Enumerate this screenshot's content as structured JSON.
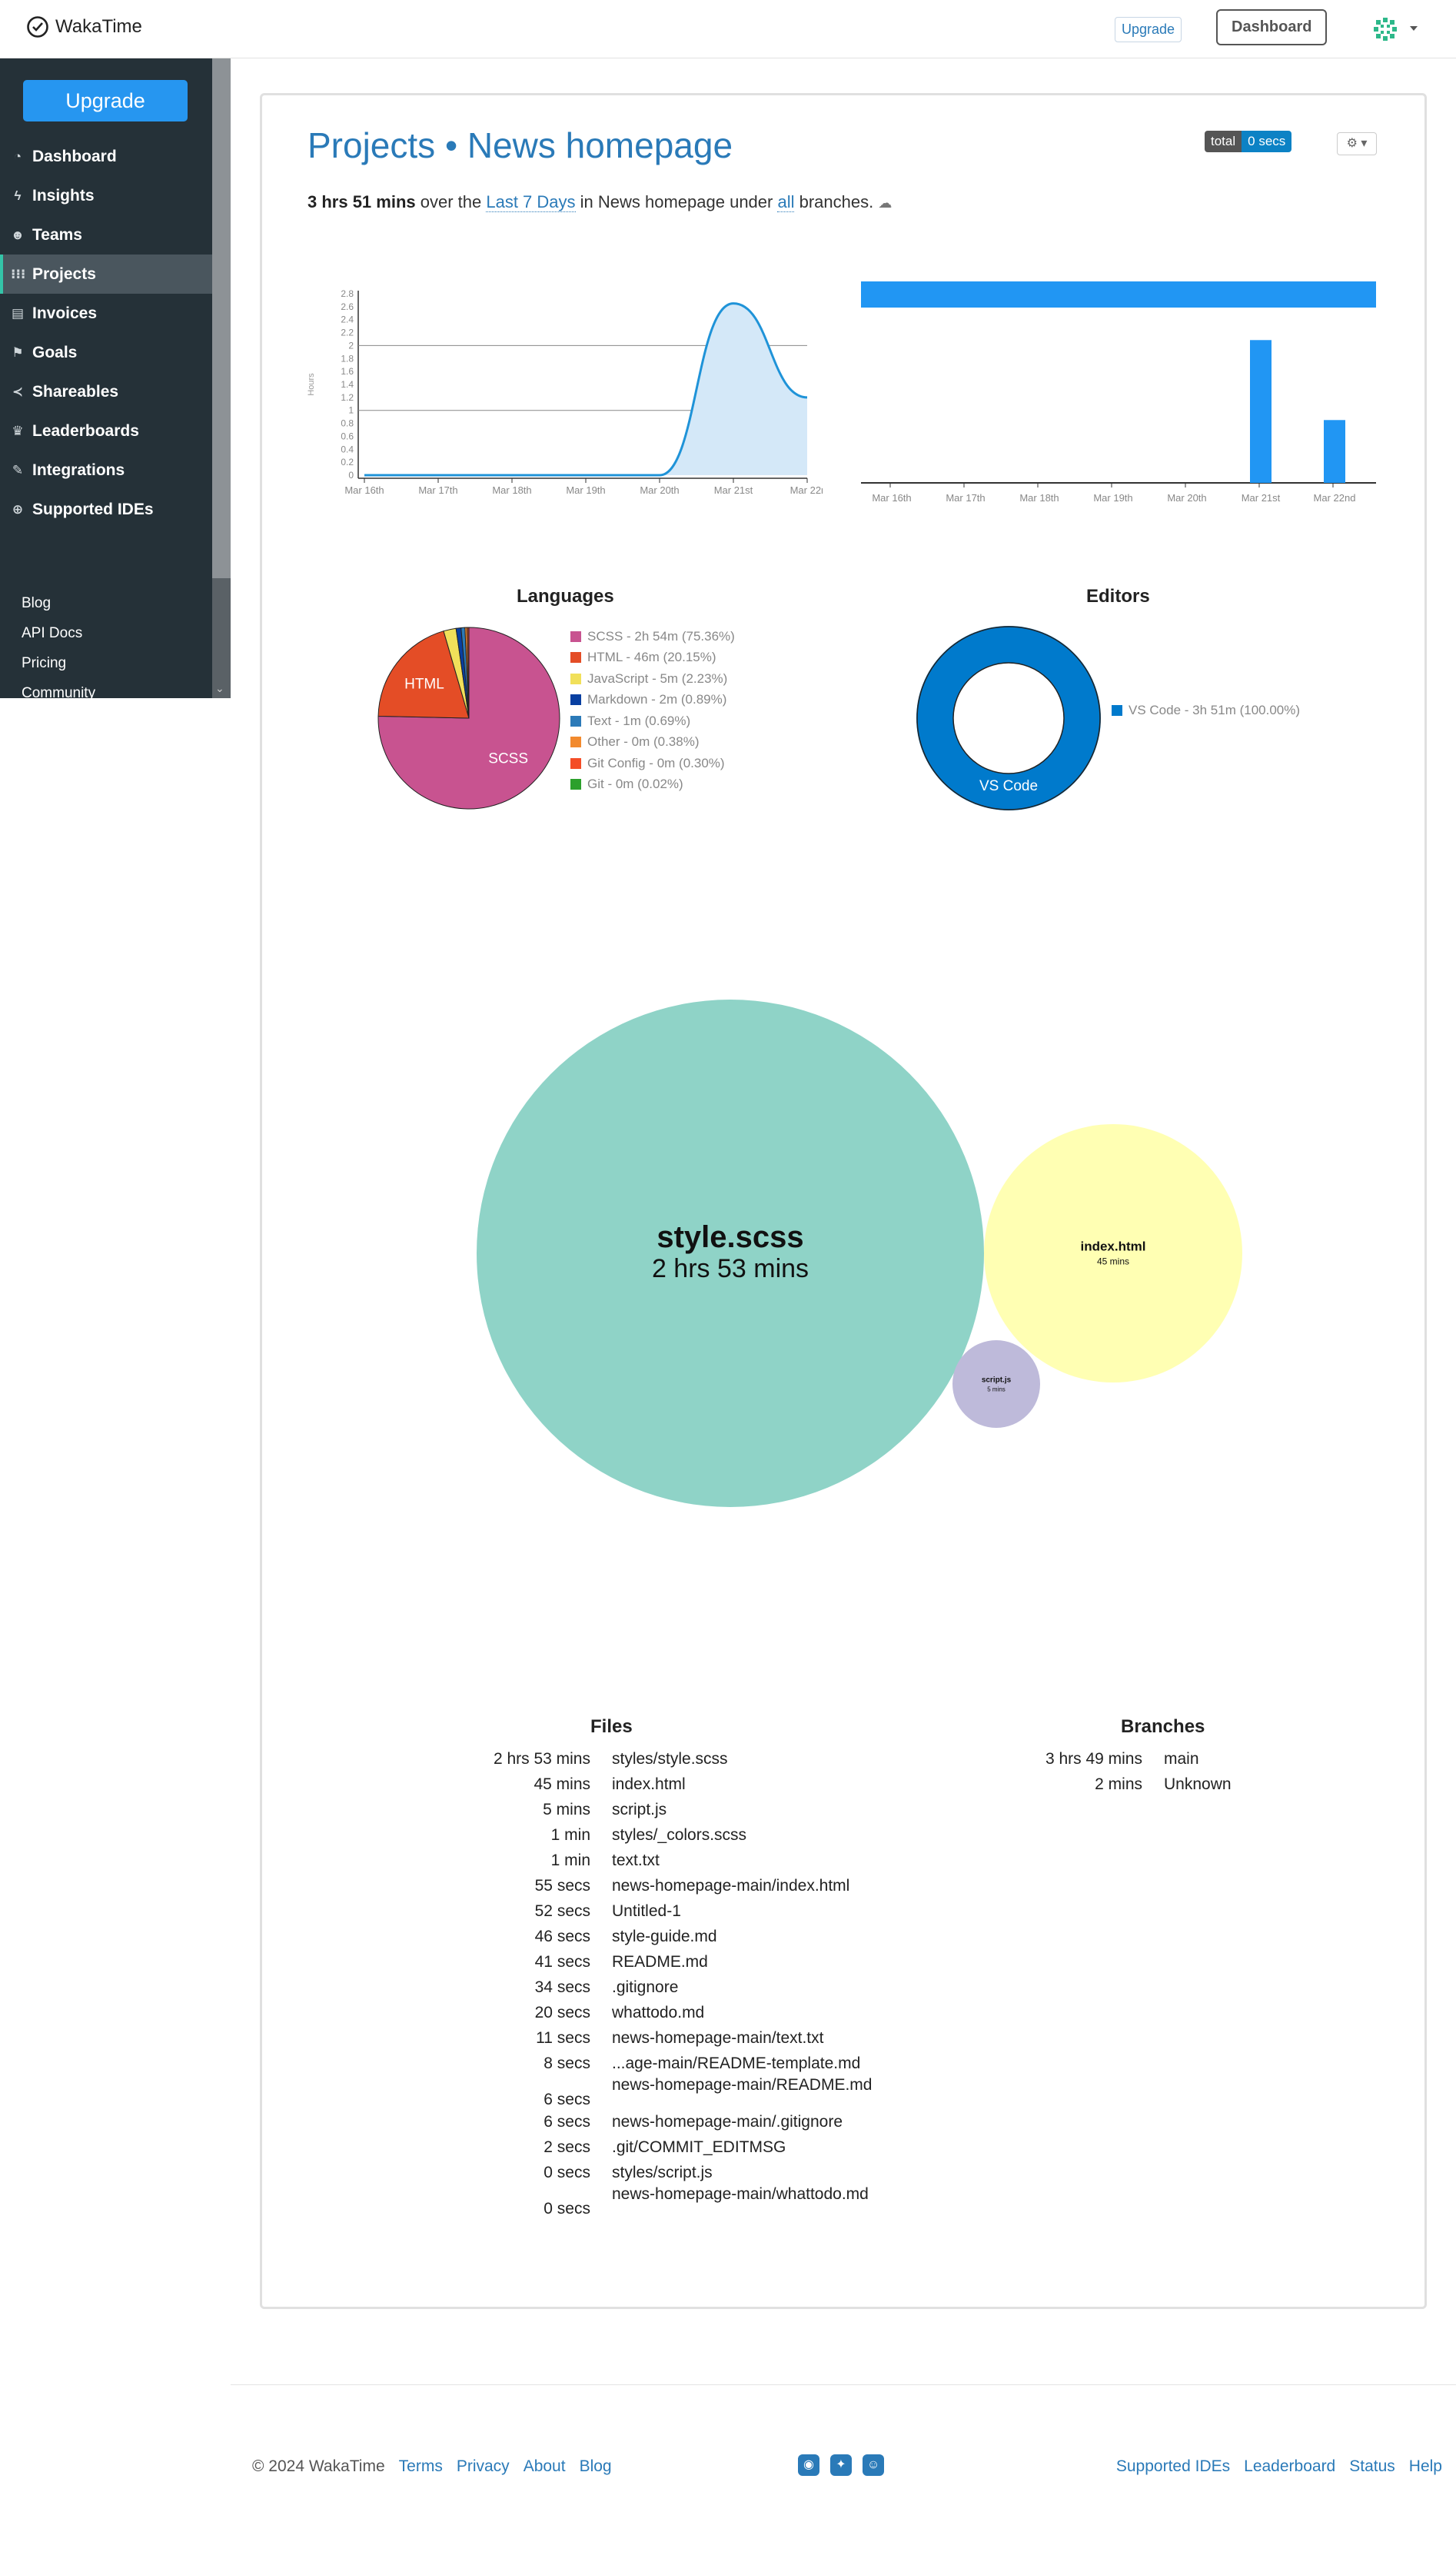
{
  "topbar": {
    "logo_text": "WakaTime",
    "upgrade_label": "Upgrade",
    "dashboard_label": "Dashboard"
  },
  "sidebar": {
    "upgrade_label": "Upgrade",
    "items": [
      {
        "label": "Dashboard",
        "icon": "tachometer-icon"
      },
      {
        "label": "Insights",
        "icon": "bolt-icon"
      },
      {
        "label": "Teams",
        "icon": "users-icon"
      },
      {
        "label": "Projects",
        "icon": "grid-icon",
        "active": true
      },
      {
        "label": "Invoices",
        "icon": "file-icon"
      },
      {
        "label": "Goals",
        "icon": "flag-icon"
      },
      {
        "label": "Shareables",
        "icon": "share-icon"
      },
      {
        "label": "Leaderboards",
        "icon": "trophy-icon"
      },
      {
        "label": "Integrations",
        "icon": "wrench-icon"
      },
      {
        "label": "Supported IDEs",
        "icon": "plus-circle-icon"
      }
    ],
    "links": [
      "Blog",
      "API Docs",
      "Pricing",
      "Community"
    ]
  },
  "header": {
    "title": "Projects • News homepage",
    "summary_bold": "3 hrs 51 mins",
    "summary_1": " over the ",
    "range_link": "Last 7 Days",
    "summary_2": " in News homepage under ",
    "branches_link": "all",
    "summary_3": " branches.",
    "badge_left": "total",
    "badge_right": "0 secs"
  },
  "chart_data": [
    {
      "type": "area",
      "ylabel": "Hours",
      "x": [
        "Mar 16th",
        "Mar 17th",
        "Mar 18th",
        "Mar 19th",
        "Mar 20th",
        "Mar 21st",
        "Mar 22r"
      ],
      "yticks": [
        "0",
        "0.2",
        "0.4",
        "0.6",
        "0.8",
        "1",
        "1.2",
        "1.4",
        "1.6",
        "1.8",
        "2",
        "2.2",
        "2.4",
        "2.6",
        "2.8"
      ],
      "values": [
        0.0,
        0.0,
        0.0,
        0.0,
        0.0,
        2.65,
        1.2
      ],
      "ylim": [
        0,
        2.8
      ]
    },
    {
      "type": "bar",
      "x": [
        "Mar 16th",
        "Mar 17th",
        "Mar 18th",
        "Mar 19th",
        "Mar 20th",
        "Mar 21st",
        "Mar 22nd"
      ],
      "values": [
        0,
        0,
        0,
        0,
        0,
        2.5,
        1.1
      ],
      "top_bar": "full range"
    },
    {
      "type": "pie",
      "title": "Languages",
      "slices": [
        {
          "label": "SCSS - 2h 54m (75.36%)",
          "name": "SCSS",
          "value": 75.36,
          "color": "#c85390"
        },
        {
          "label": "HTML - 46m (20.15%)",
          "name": "HTML",
          "value": 20.15,
          "color": "#e44d26"
        },
        {
          "label": "JavaScript - 5m (2.23%)",
          "name": "",
          "value": 2.23,
          "color": "#f1e05a"
        },
        {
          "label": "Markdown - 2m (0.89%)",
          "name": "",
          "value": 0.89,
          "color": "#083fa1"
        },
        {
          "label": "Text - 1m (0.69%)",
          "name": "",
          "value": 0.69,
          "color": "#2c7ab8"
        },
        {
          "label": "Other - 0m (0.38%)",
          "name": "",
          "value": 0.38,
          "color": "#f28a2e"
        },
        {
          "label": "Git Config - 0m (0.30%)",
          "name": "",
          "value": 0.3,
          "color": "#f44d27"
        },
        {
          "label": "Git - 0m (0.02%)",
          "name": "",
          "value": 0.02,
          "color": "#2ca02c"
        }
      ]
    },
    {
      "type": "pie",
      "title": "Editors",
      "slices": [
        {
          "label": "VS Code - 3h 51m (100.00%)",
          "name": "VS Code",
          "value": 100,
          "color": "#007acc"
        }
      ]
    },
    {
      "type": "bubble",
      "bubbles": [
        {
          "name": "style.scss",
          "time": "2 hrs 53 mins",
          "minutes": 173,
          "color": "#8fd3c7"
        },
        {
          "name": "index.html",
          "time": "45 mins",
          "minutes": 45,
          "color": "#ffffb3"
        },
        {
          "name": "script.js",
          "time": "5 mins",
          "minutes": 5,
          "color": "#bebada"
        }
      ]
    }
  ],
  "files": {
    "title": "Files",
    "rows": [
      [
        "2 hrs 53 mins",
        "styles/style.scss"
      ],
      [
        "45 mins",
        "index.html"
      ],
      [
        "5 mins",
        "script.js"
      ],
      [
        "1 min",
        "styles/_colors.scss"
      ],
      [
        "1 min",
        "text.txt"
      ],
      [
        "55 secs",
        "news-homepage-main/index.html"
      ],
      [
        "52 secs",
        "Untitled-1"
      ],
      [
        "46 secs",
        "style-guide.md"
      ],
      [
        "41 secs",
        "README.md"
      ],
      [
        "34 secs",
        ".gitignore"
      ],
      [
        "20 secs",
        "whattodo.md"
      ],
      [
        "11 secs",
        "news-homepage-main/text.txt"
      ],
      [
        "8 secs",
        "...age-main/README-template.md"
      ],
      [
        "6 secs",
        "news-homepage-main/README.md"
      ],
      [
        "6 secs",
        "news-homepage-main/.gitignore"
      ],
      [
        "2 secs",
        ".git/COMMIT_EDITMSG"
      ],
      [
        "0 secs",
        "styles/script.js"
      ],
      [
        "0 secs",
        "news-homepage-main/whattodo.md"
      ]
    ]
  },
  "branches": {
    "title": "Branches",
    "rows": [
      [
        "3 hrs 49 mins",
        "main"
      ],
      [
        "2 mins",
        "Unknown"
      ]
    ]
  },
  "footer": {
    "copyright": "© 2024 WakaTime",
    "left_links": [
      "Terms",
      "Privacy",
      "About",
      "Blog"
    ],
    "right_links": [
      "Supported IDEs",
      "Leaderboard",
      "Status",
      "Help"
    ],
    "social_icons": [
      "github-icon",
      "twitter-icon",
      "reddit-icon"
    ]
  }
}
